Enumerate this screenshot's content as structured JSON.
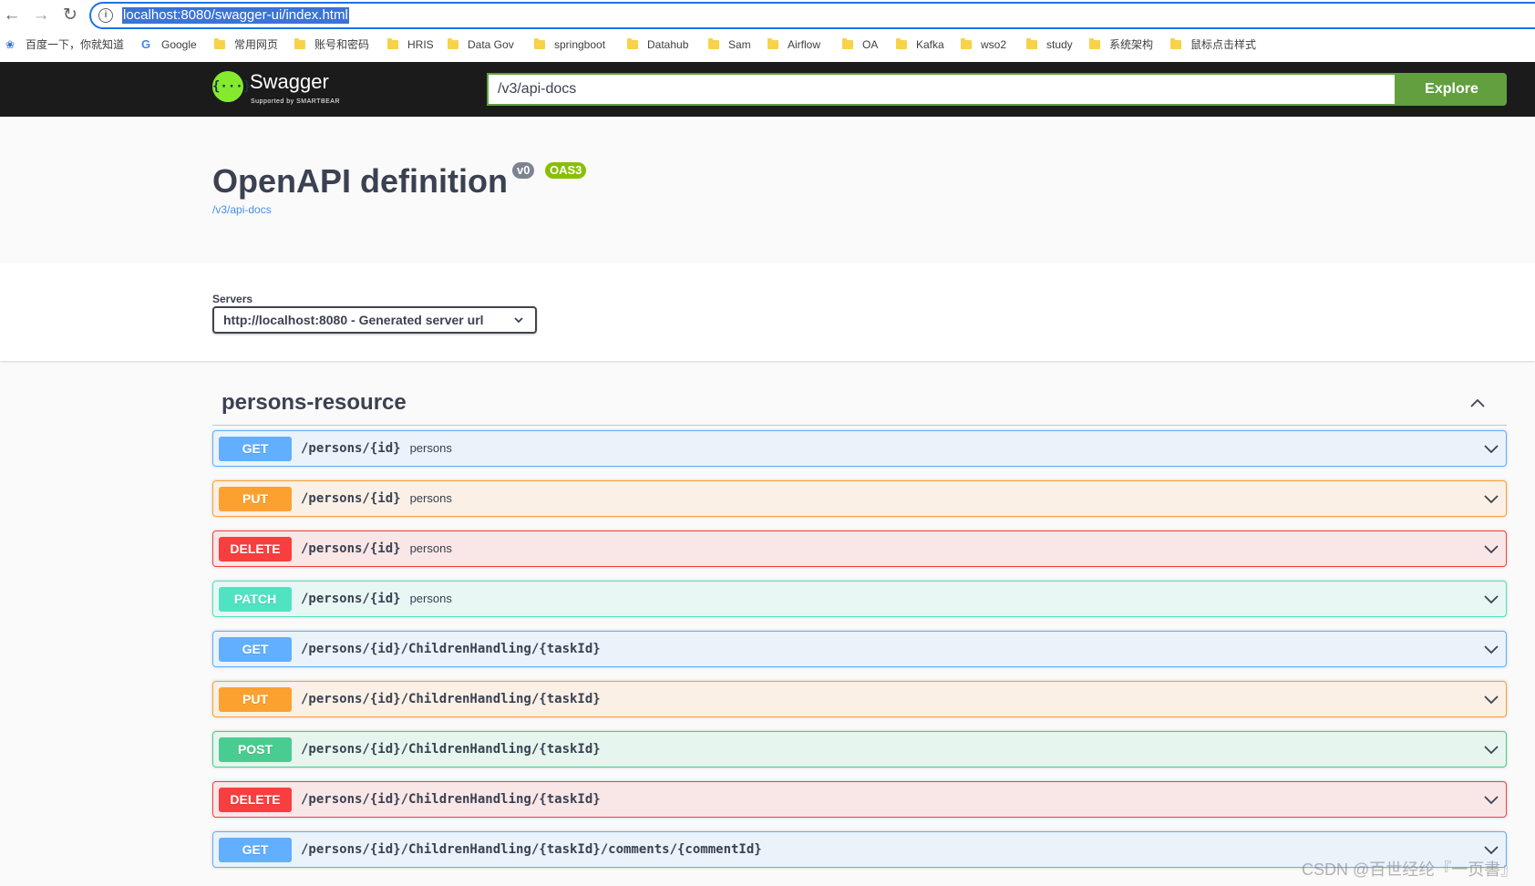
{
  "browser": {
    "url": "localhost:8080/swagger-ui/index.html",
    "back_icon": "arrow-left-icon",
    "forward_icon": "arrow-right-icon",
    "reload_icon": "reload-icon",
    "bookmarks": [
      {
        "label": "百度一下，你就知道",
        "icon": "paw-icon"
      },
      {
        "label": "Google",
        "icon": "google-icon"
      },
      {
        "label": "常用网页",
        "icon": "folder-icon"
      },
      {
        "label": "账号和密码",
        "icon": "folder-icon"
      },
      {
        "label": "HRIS",
        "icon": "folder-icon"
      },
      {
        "label": "Data Gov",
        "icon": "folder-icon"
      },
      {
        "label": "springboot",
        "icon": "folder-icon"
      },
      {
        "label": "Datahub",
        "icon": "folder-icon"
      },
      {
        "label": "Sam",
        "icon": "folder-icon"
      },
      {
        "label": "Airflow",
        "icon": "folder-icon"
      },
      {
        "label": "OA",
        "icon": "folder-icon"
      },
      {
        "label": "Kafka",
        "icon": "folder-icon"
      },
      {
        "label": "wso2",
        "icon": "folder-icon"
      },
      {
        "label": "study",
        "icon": "folder-icon"
      },
      {
        "label": "系统架构",
        "icon": "folder-icon"
      },
      {
        "label": "鼠标点击样式",
        "icon": "folder-icon"
      }
    ]
  },
  "topbar": {
    "logo_text": "Swagger",
    "logo_sub": "Supported by SMARTBEAR",
    "explore_value": "/v3/api-docs",
    "explore_label": "Explore",
    "colors": {
      "accent": "#62a03f",
      "logo": "#85ea2d",
      "bar": "#1b1b1b"
    }
  },
  "info": {
    "title": "OpenAPI definition",
    "version_badge": "v0",
    "spec_badge": "OAS3",
    "docs_link": "/v3/api-docs"
  },
  "servers": {
    "label": "Servers",
    "selected": "http://localhost:8080 - Generated server url"
  },
  "tag": {
    "name": "persons-resource",
    "expanded": true
  },
  "operations": [
    {
      "method": "GET",
      "path": "/persons/{id}",
      "summary": "persons"
    },
    {
      "method": "PUT",
      "path": "/persons/{id}",
      "summary": "persons"
    },
    {
      "method": "DELETE",
      "path": "/persons/{id}",
      "summary": "persons"
    },
    {
      "method": "PATCH",
      "path": "/persons/{id}",
      "summary": "persons"
    },
    {
      "method": "GET",
      "path": "/persons/{id}/ChildrenHandling/{taskId}",
      "summary": ""
    },
    {
      "method": "PUT",
      "path": "/persons/{id}/ChildrenHandling/{taskId}",
      "summary": ""
    },
    {
      "method": "POST",
      "path": "/persons/{id}/ChildrenHandling/{taskId}",
      "summary": ""
    },
    {
      "method": "DELETE",
      "path": "/persons/{id}/ChildrenHandling/{taskId}",
      "summary": ""
    },
    {
      "method": "GET",
      "path": "/persons/{id}/ChildrenHandling/{taskId}/comments/{commentId}",
      "summary": ""
    }
  ],
  "watermark": "CSDN @百世经纶『一页書』"
}
